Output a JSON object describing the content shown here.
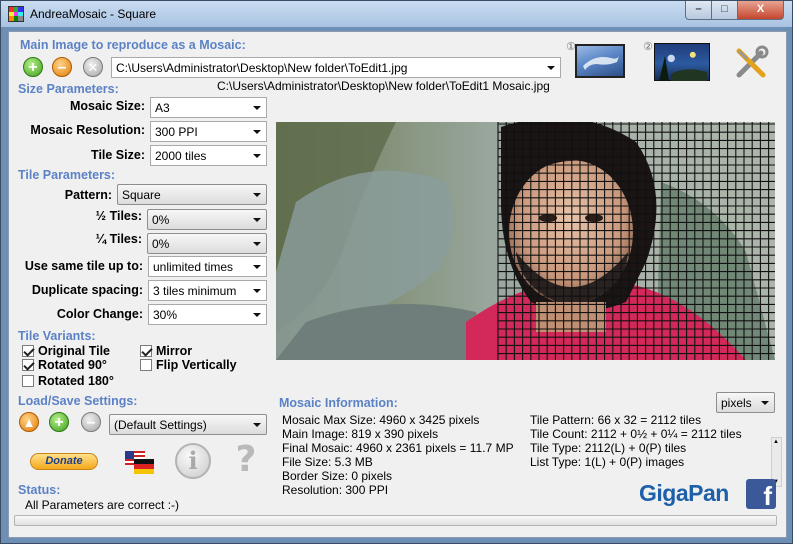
{
  "window": {
    "title": "AndreaMosaic - Square",
    "min_label": "–",
    "max_label": "□",
    "close_label": "X"
  },
  "main_image": {
    "section_label": "Main Image to reproduce as a Mosaic:",
    "path": "C:\\Users\\Administrator\\Desktop\\New folder\\ToEdit1.jpg",
    "output_path": "C:\\Users\\Administrator\\Desktop\\New folder\\ToEdit1 Mosaic.jpg",
    "add_icon": "add-icon",
    "remove_icon": "remove-icon",
    "clear_icon": "clear-icon",
    "thumb1_badge": "①",
    "thumb2_badge": "②"
  },
  "size_parameters": {
    "section_label": "Size Parameters:",
    "mosaic_size_label": "Mosaic Size:",
    "mosaic_size_value": "A3",
    "mosaic_resolution_label": "Mosaic Resolution:",
    "mosaic_resolution_value": "300 PPI",
    "tile_size_label": "Tile Size:",
    "tile_size_value": "2000 tiles"
  },
  "tile_parameters": {
    "section_label": "Tile Parameters:",
    "pattern_label": "Pattern:",
    "pattern_value": "Square",
    "half_tiles_label": "½ Tiles:",
    "half_tiles_value": "0%",
    "quarter_tiles_label": "¼ Tiles:",
    "quarter_tiles_value": "0%",
    "same_tile_label": "Use same tile up to:",
    "same_tile_value": "unlimited times",
    "duplicate_spacing_label": "Duplicate spacing:",
    "duplicate_spacing_value": "3 tiles minimum",
    "color_change_label": "Color Change:",
    "color_change_value": "30%"
  },
  "tile_variants": {
    "section_label": "Tile Variants:",
    "original_tile": {
      "label": "Original Tile",
      "checked": true
    },
    "rotated_90": {
      "label": "Rotated 90°",
      "checked": true
    },
    "rotated_180": {
      "label": "Rotated 180°",
      "checked": false
    },
    "mirror": {
      "label": "Mirror",
      "checked": true
    },
    "flip_vertically": {
      "label": "Flip Vertically",
      "checked": false
    }
  },
  "load_save": {
    "section_label": "Load/Save Settings:",
    "settings_value": "(Default Settings)"
  },
  "extras": {
    "donate_label": "Donate",
    "info_glyph": "i",
    "help_glyph": "?"
  },
  "status": {
    "section_label": "Status:",
    "message": "All Parameters are correct :-)",
    "progress": 0
  },
  "mosaic_information": {
    "section_label": "Mosaic Information:",
    "units_value": "pixels",
    "left_lines": [
      "Mosaic Max Size: 4960 x 3425 pixels",
      "Main Image: 819 x 390 pixels",
      "Final Mosaic: 4960 x 2361 pixels = 11.7 MP",
      "File Size: 5.3 MB",
      "Border Size: 0 pixels",
      "Resolution: 300 PPI"
    ],
    "right_lines": [
      "Tile Pattern: 66 x 32 = 2112 tiles",
      "Tile Count: 2112 + 0½ + 0¼ = 2112 tiles",
      "Tile Type: 2112(L) + 0(P) tiles",
      "List Type: 1(L) + 0(P) images"
    ]
  },
  "branding": {
    "gigapan": "GigaPan",
    "facebook": "f"
  },
  "colors": {
    "section_blue": "#5b82c6",
    "gigapan_blue": "#1d5fa8",
    "facebook_blue": "#3b5998"
  }
}
